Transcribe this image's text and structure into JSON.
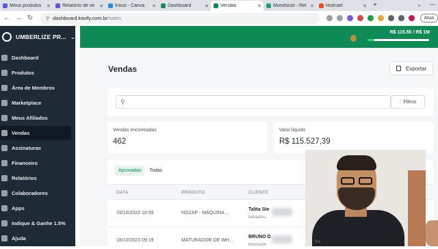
{
  "browser": {
    "tabs": [
      {
        "label": "Meus produtos",
        "color": "#5b5bd6",
        "active": false
      },
      {
        "label": "Relatório de ve",
        "color": "#5b5bd6",
        "active": false
      },
      {
        "label": "Início - Canva",
        "color": "#2d8bdb",
        "active": false
      },
      {
        "label": "Dashboard",
        "color": "#0e8a56",
        "active": false
      },
      {
        "label": "Vendas",
        "color": "#0e8a56",
        "active": true
      },
      {
        "label": "Monetizze - Rel",
        "color": "#1aa27e",
        "active": false
      },
      {
        "label": "Hotmart",
        "color": "#f04e23",
        "active": false
      }
    ],
    "new_tab": "+",
    "url_host": "dashboard.kiwify.com.br",
    "url_path": "/sales",
    "profile_label": "Atua"
  },
  "sidebar": {
    "brand": "UMBERLIZE PR...",
    "items": [
      {
        "label": "Dashboard"
      },
      {
        "label": "Produtos"
      },
      {
        "label": "Área de Membros"
      },
      {
        "label": "Marketplace"
      },
      {
        "label": "Meus Afiliados"
      },
      {
        "label": "Vendas"
      },
      {
        "label": "Assinaturas"
      },
      {
        "label": "Financeiro"
      },
      {
        "label": "Relatórios"
      },
      {
        "label": "Colaboradores"
      },
      {
        "label": "Apps"
      },
      {
        "label": "Indique & Ganhe 1.5%"
      },
      {
        "label": "Ajuda"
      }
    ]
  },
  "topbar": {
    "revenue": "R$ 115.5k / R$ 1M",
    "progress_fraction": 0.115,
    "accent": "#0e8a56"
  },
  "page": {
    "title": "Vendas",
    "export_label": "Exportar",
    "filters_label": "Filtros",
    "search_placeholder": ""
  },
  "stats": {
    "sales_found_label": "Vendas encontradas",
    "sales_found_value": "462",
    "net_value_label": "Valor líquido",
    "net_value_value": "R$ 115.527,39"
  },
  "table": {
    "tabs": [
      {
        "label": "Aprovadas"
      },
      {
        "label": "Todas"
      }
    ],
    "columns": [
      "DATA",
      "PRODUTO",
      "CLIENTE"
    ],
    "rows": [
      {
        "date": "19/10/2023 10:59",
        "product": "NOZAP - MÁQUINA ...",
        "client_name": "Talita Ste",
        "client_email": "talitastnu"
      },
      {
        "date": "18/10/2023 09:19",
        "product": "MATURADOR DE WH...",
        "client_name": "BRUNO D",
        "client_email": "brunosilv"
      }
    ]
  },
  "webcam": {
    "caption": "Pix"
  }
}
